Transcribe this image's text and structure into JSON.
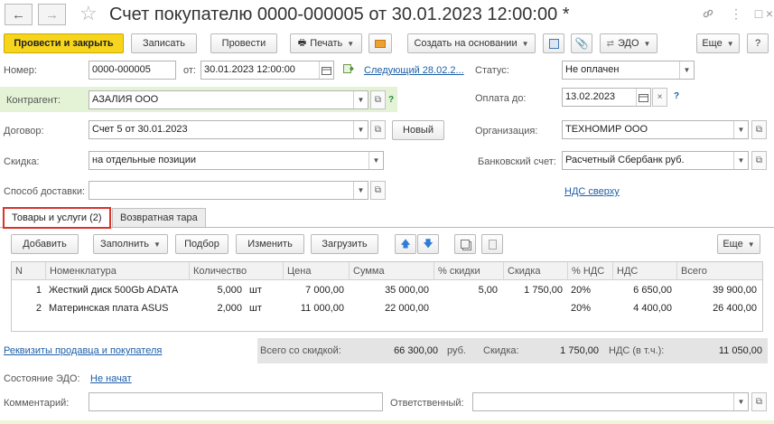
{
  "window": {
    "title": "Счет покупателю 0000-000005 от 30.01.2023 12:00:00 *",
    "back_icon": "←",
    "forward_icon": "→",
    "star_icon": "☆",
    "link_icon": "🔗",
    "more_icon": "⋮",
    "maximize_icon": "□",
    "close_icon": "×"
  },
  "toolbar": {
    "post_close": "Провести и закрыть",
    "save": "Записать",
    "post": "Провести",
    "print": "Печать",
    "create_based": "Создать на основании",
    "edo": "ЭДО",
    "more": "Еще",
    "help": "?"
  },
  "header": {
    "number_label": "Номер:",
    "number": "0000-000005",
    "from_label": "от:",
    "date": "30.01.2023 12:00:00",
    "next_link": "Следующий 28.02.2...",
    "status_label": "Статус:",
    "status": "Не оплачен",
    "counterparty_label": "Контрагент:",
    "counterparty": "АЗАЛИЯ ООО",
    "payment_due_label": "Оплата до:",
    "payment_due": "13.02.2023",
    "contract_label": "Договор:",
    "contract": "Счет 5 от 30.01.2023",
    "new_button": "Новый",
    "org_label": "Организация:",
    "org": "ТЕХНОМИР ООО",
    "discount_label": "Скидка:",
    "discount": "на отдельные позиции",
    "bank_label": "Банковский счет:",
    "bank": "Расчетный Сбербанк руб.",
    "delivery_label": "Способ доставки:",
    "delivery": "",
    "vat_link": "НДС сверху",
    "q": "?"
  },
  "tabs": {
    "goods": "Товары и услуги (2)",
    "containers": "Возвратная тара"
  },
  "table_toolbar": {
    "add": "Добавить",
    "fill": "Заполнить",
    "select": "Подбор",
    "change": "Изменить",
    "load": "Загрузить",
    "more": "Еще"
  },
  "table": {
    "columns": [
      "N",
      "Номенклатура",
      "Количество",
      "Цена",
      "Сумма",
      "% скидки",
      "Скидка",
      "% НДС",
      "НДС",
      "Всего"
    ],
    "rows": [
      {
        "n": "1",
        "name": "Жесткий диск 500Gb ADATA",
        "qty": "5,000",
        "unit": "шт",
        "price": "7 000,00",
        "sum": "35 000,00",
        "disc_pct": "5,00",
        "disc": "1 750,00",
        "vat_pct": "20%",
        "vat": "6 650,00",
        "total": "39 900,00"
      },
      {
        "n": "2",
        "name": "Материнская плата ASUS",
        "qty": "2,000",
        "unit": "шт",
        "price": "11 000,00",
        "sum": "22 000,00",
        "disc_pct": "",
        "disc": "",
        "vat_pct": "20%",
        "vat": "4 400,00",
        "total": "26 400,00"
      }
    ]
  },
  "footer": {
    "requisites_link": "Реквизиты продавца и покупателя",
    "total_label": "Всего со скидкой:",
    "total": "66 300,00",
    "currency": "руб.",
    "discount_label": "Скидка:",
    "discount": "1 750,00",
    "vat_label": "НДС (в т.ч.):",
    "vat": "11 050,00",
    "edo_state_label": "Состояние ЭДО:",
    "edo_state": "Не начат",
    "comment_label": "Комментарий:",
    "comment": "",
    "responsible_label": "Ответственный:",
    "responsible": ""
  }
}
